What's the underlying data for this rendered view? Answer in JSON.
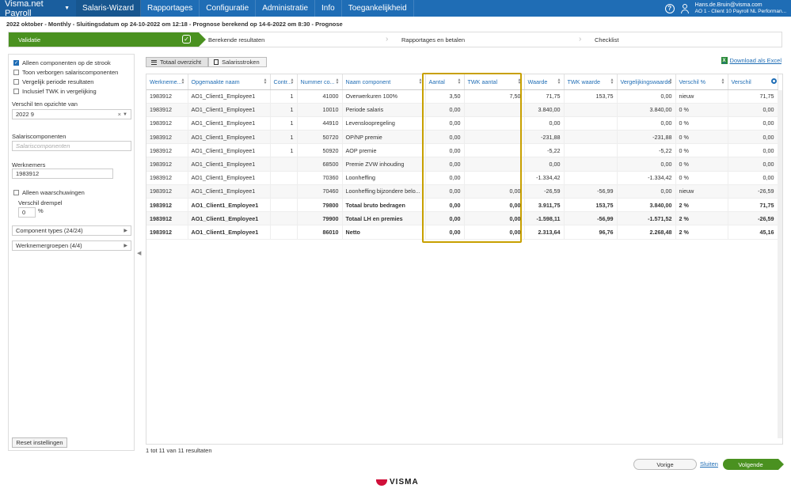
{
  "nav": {
    "brand": "Visma.net Payroll",
    "items": [
      {
        "label": "Salaris-Wizard",
        "active": true
      },
      {
        "label": "Rapportages",
        "active": false
      },
      {
        "label": "Configuratie",
        "active": false
      },
      {
        "label": "Administratie",
        "active": false
      },
      {
        "label": "Info",
        "active": false
      },
      {
        "label": "Toegankelijkheid",
        "active": false
      }
    ],
    "user_email": "Hans.de.Bruin@visma.com",
    "user_context": "AO 1 - Client 10 Payroll NL Performan..."
  },
  "subheader": "2022 oktober - Monthly - Sluitingsdatum op 24-10-2022 om 12:18 - Prognose berekend op 14-6-2022 om 8:30 - Prognose",
  "wizard": {
    "steps": [
      "Validatie",
      "Berekende resultaten",
      "Rapportages en betalen",
      "Checklist"
    ]
  },
  "filters": {
    "checkboxes": [
      {
        "label": "Alleen componenten op de strook",
        "checked": true
      },
      {
        "label": "Toon verborgen salariscomponenten",
        "checked": false
      },
      {
        "label": "Vergelijk periode resultaten",
        "checked": false
      },
      {
        "label": "Inclusief TWK in vergelijking",
        "checked": false
      }
    ],
    "compare_label": "Verschil ten opzichte van",
    "compare_value": "2022 9",
    "salary_components_label": "Salariscomponenten",
    "salary_components_placeholder": "Salariscomponenten",
    "employees_label": "Werknemers",
    "employees_value": "1983912",
    "warnings_label": "Alleen waarschuwingen",
    "threshold_label": "Verschil drempel",
    "threshold_value": "0",
    "threshold_unit": "%",
    "component_types": "Component types (24/24)",
    "employee_groups": "Werknemergroepen (4/4)",
    "reset_label": "Reset instellingen"
  },
  "tabs": [
    "Totaal overzicht",
    "Salarisstroken"
  ],
  "download_label": "Download als Excel",
  "table": {
    "columns": [
      "Werkneme...",
      "Opgemaakte naam",
      "Contr...",
      "Nummer co...",
      "Naam component",
      "Aantal",
      "TWK aantal",
      "Waarde",
      "TWK waarde",
      "Vergelijkingswaarde",
      "Verschil %",
      "Verschil"
    ],
    "rows": [
      {
        "bold": false,
        "cells": [
          "1983912",
          "AO1_Client1_Employee1",
          "1",
          "41000",
          "Overwerkuren 100%",
          "3,50",
          "7,50",
          "71,75",
          "153,75",
          "0,00",
          "nieuw",
          "71,75"
        ]
      },
      {
        "bold": false,
        "cells": [
          "1983912",
          "AO1_Client1_Employee1",
          "1",
          "10010",
          "Periode salaris",
          "0,00",
          "",
          "3.840,00",
          "",
          "3.840,00",
          "0 %",
          "0,00"
        ]
      },
      {
        "bold": false,
        "cells": [
          "1983912",
          "AO1_Client1_Employee1",
          "1",
          "44910",
          "Levensloopregeling",
          "0,00",
          "",
          "0,00",
          "",
          "0,00",
          "0 %",
          "0,00"
        ]
      },
      {
        "bold": false,
        "cells": [
          "1983912",
          "AO1_Client1_Employee1",
          "1",
          "50720",
          "OP/NP premie",
          "0,00",
          "",
          "-231,88",
          "",
          "-231,88",
          "0 %",
          "0,00"
        ]
      },
      {
        "bold": false,
        "cells": [
          "1983912",
          "AO1_Client1_Employee1",
          "1",
          "50920",
          "AOP premie",
          "0,00",
          "",
          "-5,22",
          "",
          "-5,22",
          "0 %",
          "0,00"
        ]
      },
      {
        "bold": false,
        "cells": [
          "1983912",
          "AO1_Client1_Employee1",
          "",
          "68500",
          "Premie ZVW inhouding",
          "0,00",
          "",
          "0,00",
          "",
          "0,00",
          "0 %",
          "0,00"
        ]
      },
      {
        "bold": false,
        "cells": [
          "1983912",
          "AO1_Client1_Employee1",
          "",
          "70360",
          "Loonheffing",
          "0,00",
          "",
          "-1.334,42",
          "",
          "-1.334,42",
          "0 %",
          "0,00"
        ]
      },
      {
        "bold": false,
        "cells": [
          "1983912",
          "AO1_Client1_Employee1",
          "",
          "70460",
          "Loonheffing bijzondere belo...",
          "0,00",
          "0,00",
          "-26,59",
          "-56,99",
          "0,00",
          "nieuw",
          "-26,59"
        ]
      },
      {
        "bold": true,
        "cells": [
          "1983912",
          "AO1_Client1_Employee1",
          "",
          "79800",
          "Totaal bruto bedragen",
          "0,00",
          "0,00",
          "3.911,75",
          "153,75",
          "3.840,00",
          "2 %",
          "71,75"
        ]
      },
      {
        "bold": true,
        "cells": [
          "1983912",
          "AO1_Client1_Employee1",
          "",
          "79900",
          "Totaal LH en premies",
          "0,00",
          "0,00",
          "-1.598,11",
          "-56,99",
          "-1.571,52",
          "2 %",
          "-26,59"
        ]
      },
      {
        "bold": true,
        "cells": [
          "1983912",
          "AO1_Client1_Employee1",
          "",
          "86010",
          "Netto",
          "0,00",
          "0,00",
          "2.313,64",
          "96,76",
          "2.268,48",
          "2 %",
          "45,16"
        ]
      }
    ]
  },
  "footer_info": "1 tot 11 van 11 resultaten",
  "buttons": {
    "prev": "Vorige",
    "close": "Sluiten",
    "next": "Volgende"
  },
  "logo": "VISMA",
  "colors": {
    "nav": "#1f6db5",
    "accent_green": "#4a9120",
    "highlight": "#c8a000"
  }
}
